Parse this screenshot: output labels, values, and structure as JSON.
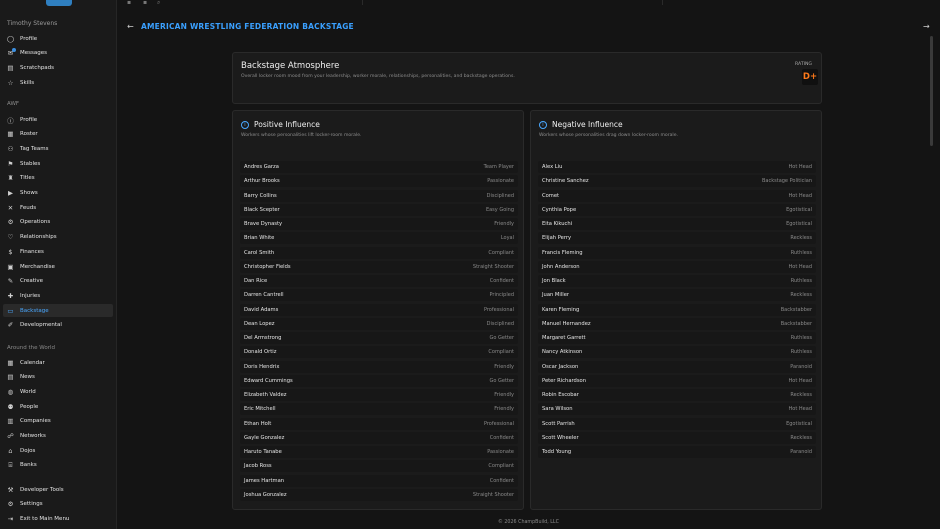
{
  "sidebar": {
    "user": "Timothy Stevens",
    "personal": [
      {
        "label": "Profile",
        "icon": "user-icon"
      },
      {
        "label": "Messages",
        "icon": "message-icon",
        "badge": true
      },
      {
        "label": "Scratchpads",
        "icon": "note-icon"
      },
      {
        "label": "Skills",
        "icon": "star-icon"
      }
    ],
    "company_title": "AWF",
    "company": [
      {
        "label": "Profile",
        "icon": "info-icon"
      },
      {
        "label": "Roster",
        "icon": "roster-icon"
      },
      {
        "label": "Tag Teams",
        "icon": "tag-team-icon"
      },
      {
        "label": "Stables",
        "icon": "stables-icon"
      },
      {
        "label": "Titles",
        "icon": "title-icon"
      },
      {
        "label": "Shows",
        "icon": "shows-icon"
      },
      {
        "label": "Feuds",
        "icon": "feud-icon"
      },
      {
        "label": "Operations",
        "icon": "gear-icon"
      },
      {
        "label": "Relationships",
        "icon": "relationship-icon"
      },
      {
        "label": "Finances",
        "icon": "finance-icon"
      },
      {
        "label": "Merchandise",
        "icon": "merch-icon"
      },
      {
        "label": "Creative",
        "icon": "creative-icon"
      },
      {
        "label": "Injuries",
        "icon": "injury-icon"
      },
      {
        "label": "Backstage",
        "icon": "backstage-icon",
        "active": true
      },
      {
        "label": "Developmental",
        "icon": "pen-icon"
      }
    ],
    "world_title": "Around the World",
    "world": [
      {
        "label": "Calendar",
        "icon": "calendar-icon"
      },
      {
        "label": "News",
        "icon": "news-icon"
      },
      {
        "label": "World",
        "icon": "globe-icon"
      },
      {
        "label": "People",
        "icon": "people-icon"
      },
      {
        "label": "Companies",
        "icon": "company-icon"
      },
      {
        "label": "Networks",
        "icon": "network-icon"
      },
      {
        "label": "Dojos",
        "icon": "dojo-icon"
      },
      {
        "label": "Banks",
        "icon": "bank-icon"
      }
    ],
    "bottom": [
      {
        "label": "Developer Tools",
        "icon": "tools-icon"
      },
      {
        "label": "Settings",
        "icon": "gear-icon"
      },
      {
        "label": "Exit to Main Menu",
        "icon": "exit-icon"
      }
    ]
  },
  "header": {
    "title": "AMERICAN WRESTLING FEDERATION BACKSTAGE",
    "back_icon": "arrow-left-icon",
    "forward_icon": "arrow-right-icon"
  },
  "atmosphere": {
    "title": "Backstage Atmosphere",
    "description": "Overall locker room mood from your leadership, worker morale, relationships, personalities, and backstage operations.",
    "rating_label": "RATING",
    "rating": "D+",
    "rating_color": "#ff7a1a"
  },
  "positive": {
    "title": "Positive Influence",
    "description": "Workers whose personalities lift locker-room morale.",
    "rows": [
      {
        "name": "Andres Garza",
        "trait": "Team Player"
      },
      {
        "name": "Arthur Brooks",
        "trait": "Passionate"
      },
      {
        "name": "Barry Collins",
        "trait": "Disciplined"
      },
      {
        "name": "Black Scepter",
        "trait": "Easy Going"
      },
      {
        "name": "Brave Dynasty",
        "trait": "Friendly"
      },
      {
        "name": "Brian White",
        "trait": "Loyal"
      },
      {
        "name": "Carol Smith",
        "trait": "Compliant"
      },
      {
        "name": "Christopher Fields",
        "trait": "Straight Shooter"
      },
      {
        "name": "Dan Rice",
        "trait": "Confident"
      },
      {
        "name": "Darren Cantrell",
        "trait": "Principled"
      },
      {
        "name": "David Adams",
        "trait": "Professional"
      },
      {
        "name": "Dean Lopez",
        "trait": "Disciplined"
      },
      {
        "name": "Del Armstrong",
        "trait": "Go Getter"
      },
      {
        "name": "Donald Ortiz",
        "trait": "Compliant"
      },
      {
        "name": "Doris Hendrix",
        "trait": "Friendly"
      },
      {
        "name": "Edward Cummings",
        "trait": "Go Getter"
      },
      {
        "name": "Elizabeth Valdez",
        "trait": "Friendly"
      },
      {
        "name": "Eric Mitchell",
        "trait": "Friendly"
      },
      {
        "name": "Ethan Holt",
        "trait": "Professional"
      },
      {
        "name": "Gayle Gonzalez",
        "trait": "Confident"
      },
      {
        "name": "Haruto Tanabe",
        "trait": "Passionate"
      },
      {
        "name": "Jacob Ross",
        "trait": "Compliant"
      },
      {
        "name": "James Hartman",
        "trait": "Confident"
      },
      {
        "name": "Joshua Gonzalez",
        "trait": "Straight Shooter"
      }
    ]
  },
  "negative": {
    "title": "Negative Influence",
    "description": "Workers whose personalities drag down locker-room morale.",
    "rows": [
      {
        "name": "Alex Liu",
        "trait": "Hot Head"
      },
      {
        "name": "Christine Sanchez",
        "trait": "Backstage Politician"
      },
      {
        "name": "Comet",
        "trait": "Hot Head"
      },
      {
        "name": "Cynthia Pope",
        "trait": "Egotistical"
      },
      {
        "name": "Eita Kikuchi",
        "trait": "Egotistical"
      },
      {
        "name": "Elijah Perry",
        "trait": "Reckless"
      },
      {
        "name": "Francis Fleming",
        "trait": "Ruthless"
      },
      {
        "name": "John Anderson",
        "trait": "Hot Head"
      },
      {
        "name": "Jon Black",
        "trait": "Ruthless"
      },
      {
        "name": "Juan Miller",
        "trait": "Reckless"
      },
      {
        "name": "Karen Fleming",
        "trait": "Backstabber"
      },
      {
        "name": "Manuel Hernandez",
        "trait": "Backstabber"
      },
      {
        "name": "Margaret Garrett",
        "trait": "Ruthless"
      },
      {
        "name": "Nancy Atkinson",
        "trait": "Ruthless"
      },
      {
        "name": "Oscar Jackson",
        "trait": "Paranoid"
      },
      {
        "name": "Peter Richardson",
        "trait": "Hot Head"
      },
      {
        "name": "Robin Escobar",
        "trait": "Reckless"
      },
      {
        "name": "Sara Wilson",
        "trait": "Hot Head"
      },
      {
        "name": "Scott Parrish",
        "trait": "Egotistical"
      },
      {
        "name": "Scott Wheeler",
        "trait": "Reckless"
      },
      {
        "name": "Todd Young",
        "trait": "Paranoid"
      }
    ]
  },
  "footer": {
    "text": "© 2026 ChampBuild, LLC"
  },
  "colors": {
    "accent": "#3aa0ff",
    "background": "#141414",
    "panel": "#1b1b1b"
  }
}
